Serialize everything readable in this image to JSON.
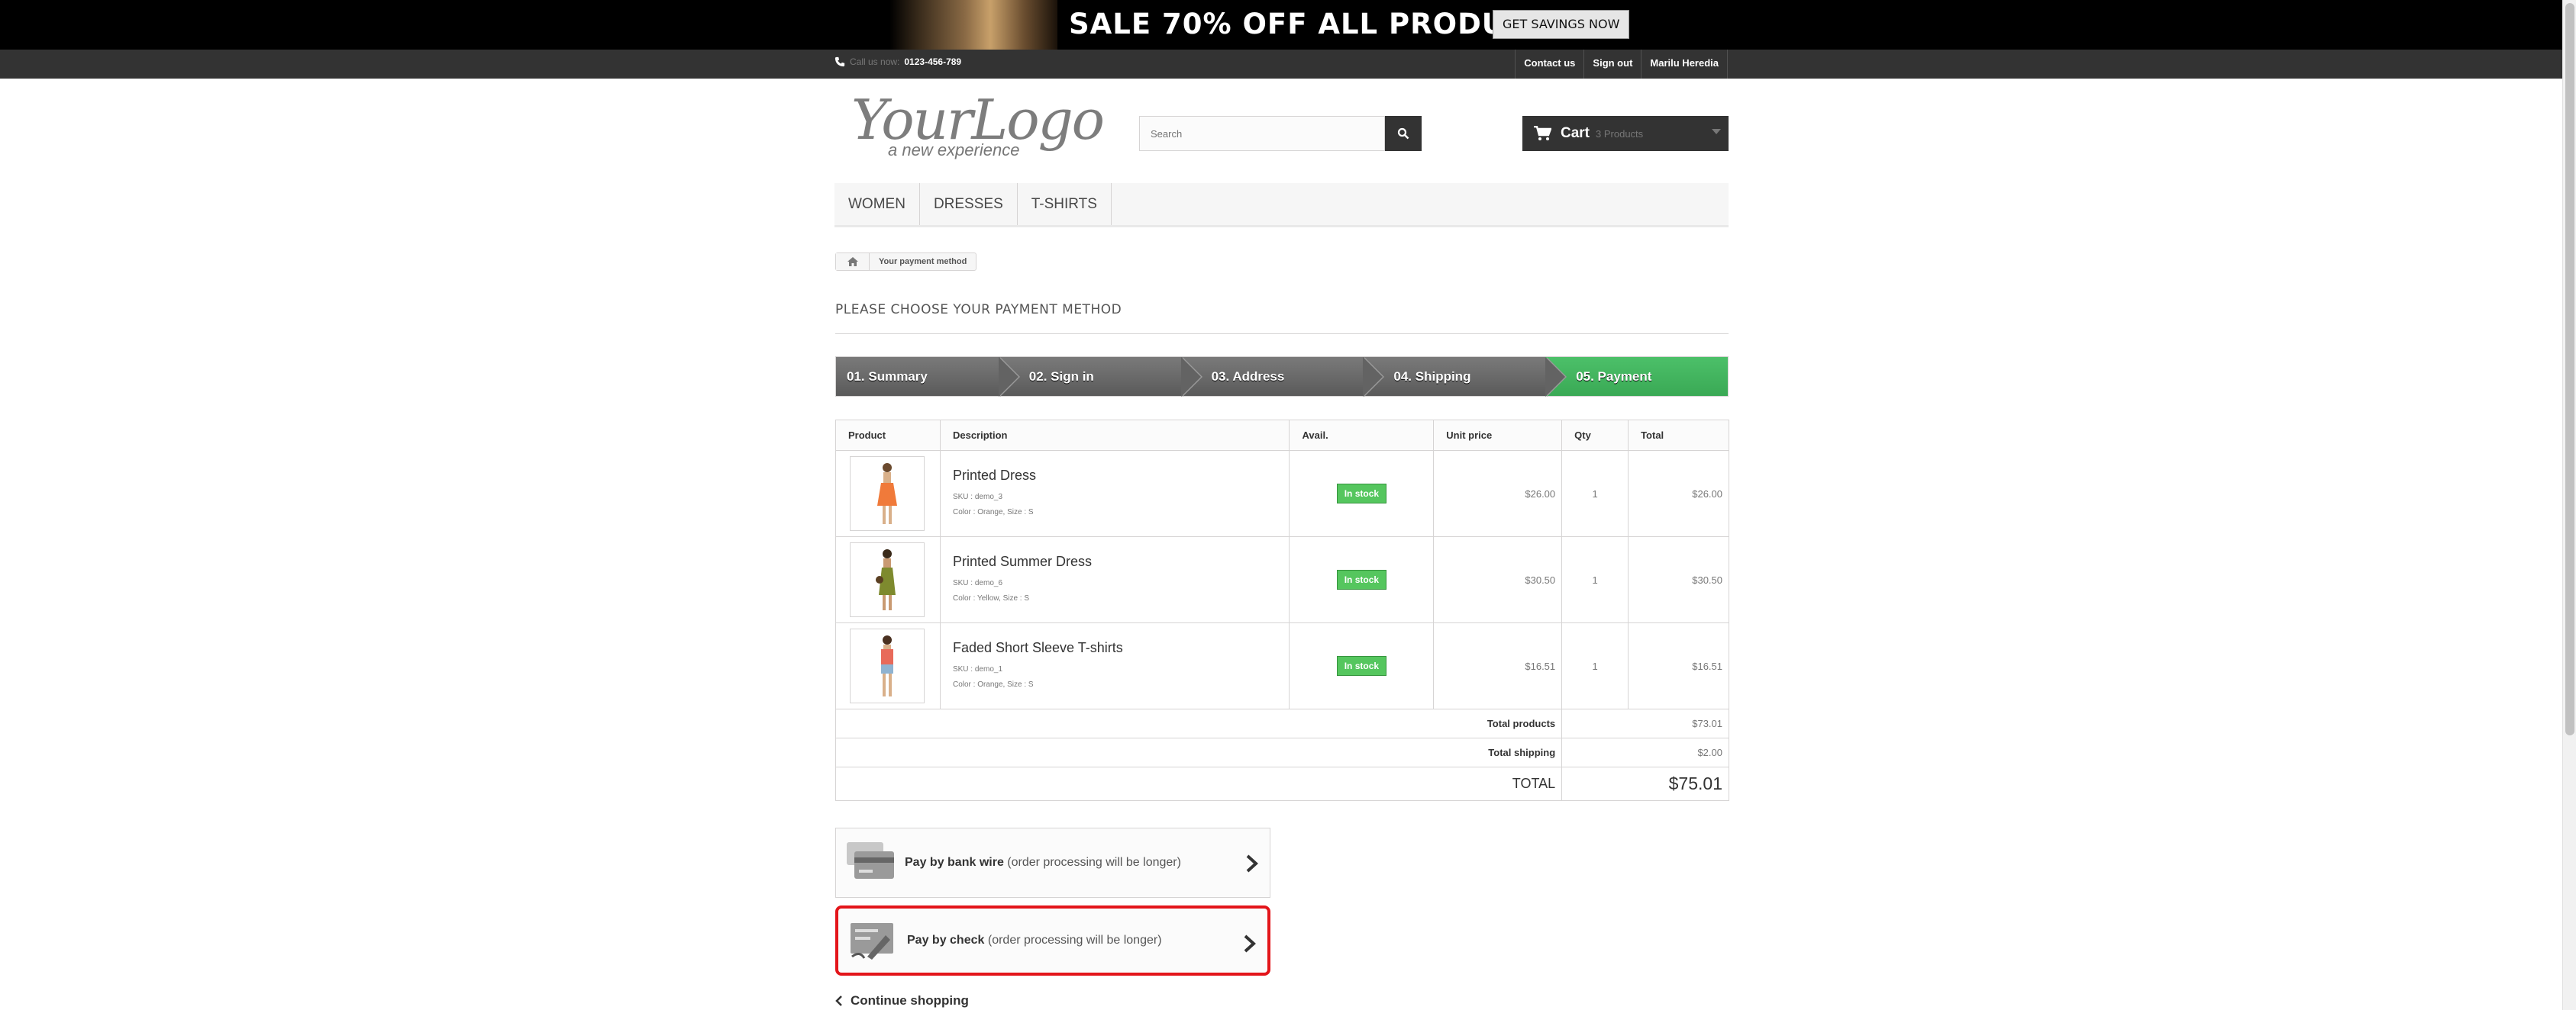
{
  "banner": {
    "headline": "SALE 70% OFF ALL PRODUCTS",
    "button": "GET SAVINGS NOW"
  },
  "topbar": {
    "call_label": "Call us now:",
    "phone": "0123-456-789",
    "links": [
      "Contact us",
      "Sign out",
      "Marilu Heredia"
    ]
  },
  "logo": {
    "main": "YourLogo",
    "tagline": "a new experience"
  },
  "search": {
    "placeholder": "Search"
  },
  "cart": {
    "label": "Cart",
    "count": "3 Products"
  },
  "menu": [
    "WOMEN",
    "DRESSES",
    "T-SHIRTS"
  ],
  "breadcrumb": {
    "current": "Your payment method"
  },
  "page_title": "PLEASE CHOOSE YOUR PAYMENT METHOD",
  "steps": [
    "01. Summary",
    "02. Sign in",
    "03. Address",
    "04. Shipping",
    "05. Payment"
  ],
  "active_step": "05. Payment",
  "table": {
    "headers": [
      "Product",
      "Description",
      "Avail.",
      "Unit price",
      "Qty",
      "Total"
    ],
    "rows": [
      {
        "name": "Printed Dress",
        "sku": "SKU : demo_3",
        "attrs": "Color : Orange, Size : S",
        "avail": "In stock",
        "unit": "$26.00",
        "qty": "1",
        "total": "$26.00",
        "color": "#f07a3a"
      },
      {
        "name": "Printed Summer Dress",
        "sku": "SKU : demo_6",
        "attrs": "Color : Yellow, Size : S",
        "avail": "In stock",
        "unit": "$30.50",
        "qty": "1",
        "total": "$30.50",
        "color": "#7e8a2e"
      },
      {
        "name": "Faded Short Sleeve T-shirts",
        "sku": "SKU : demo_1",
        "attrs": "Color : Orange, Size : S",
        "avail": "In stock",
        "unit": "$16.51",
        "qty": "1",
        "total": "$16.51",
        "color": "#e86a5a"
      }
    ],
    "total_products_label": "Total products",
    "total_products": "$73.01",
    "total_shipping_label": "Total shipping",
    "total_shipping": "$2.00",
    "grand_label": "TOTAL",
    "grand_total": "$75.01"
  },
  "payment": {
    "bank": {
      "bold": "Pay by bank wire",
      "note": "(order processing will be longer)"
    },
    "check": {
      "bold": "Pay by check",
      "note": "(order processing will be longer)"
    }
  },
  "continue_label": "Continue shopping",
  "colors": {
    "accent_green": "#46a74e",
    "selected_border": "#e3151a",
    "dark": "#333333"
  }
}
